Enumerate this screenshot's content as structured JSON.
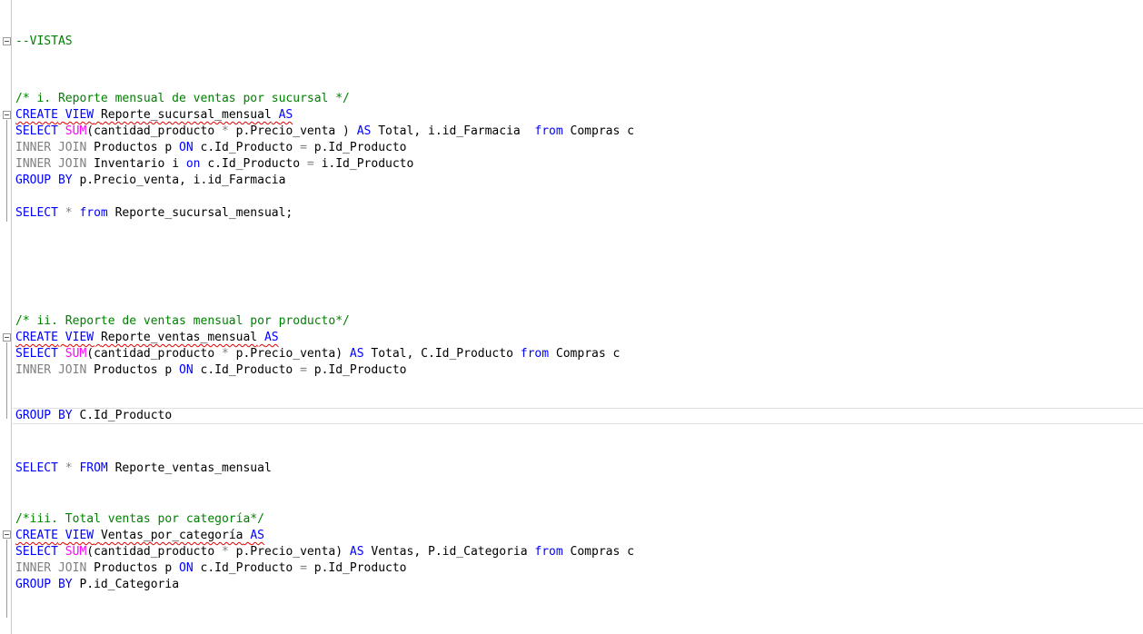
{
  "code": {
    "l1": "--VISTAS",
    "l3": "/* i. Reporte mensual de ventas por sucursal */",
    "create": "CREATE",
    "view": "VIEW",
    "as": "AS",
    "select": "SELECT",
    "sum": "SUM",
    "from": "from",
    "FROM": "FROM",
    "on_upper": "ON",
    "on_lower": "on",
    "inner": "INNER",
    "join": "JOIN",
    "group": "GROUP",
    "by": "BY",
    "star": "*",
    "mul": "*",
    "eq": "=",
    "v1_name": "Reporte_sucursal_mensual",
    "v1_select_a": "(cantidad_producto",
    "v1_select_b": "p.Precio_venta )",
    "v1_select_c": "Total, i.id_Farmacia  ",
    "compras_c": "Compras c",
    "prod_p": "Productos p",
    "c_id": "c.Id_Producto",
    "p_id": "p.Id_Producto",
    "inv_i": "Inventario i",
    "i_id": "i.Id_Producto",
    "v1_group": "p.Precio_venta, i.id_Farmacia",
    "sel1_target": "Reporte_sucursal_mensual;",
    "l13": "/* ii. Reporte de ventas mensual por producto*/",
    "v2_name": "Reporte_ventas_mensual",
    "v2_select_b": "p.Precio_venta)",
    "v2_select_c": "Total, C.Id_Producto",
    "v2_group": "C.Id_Producto",
    "sel2_target": "Reporte_ventas_mensual",
    "l22": "/*iii. Total ventas por categoría*/",
    "v3_name": "Ventas_por_categoría",
    "v3_select_c": "Ventas, P.id_Categoria",
    "v3_group": "P.id_Categoria"
  }
}
